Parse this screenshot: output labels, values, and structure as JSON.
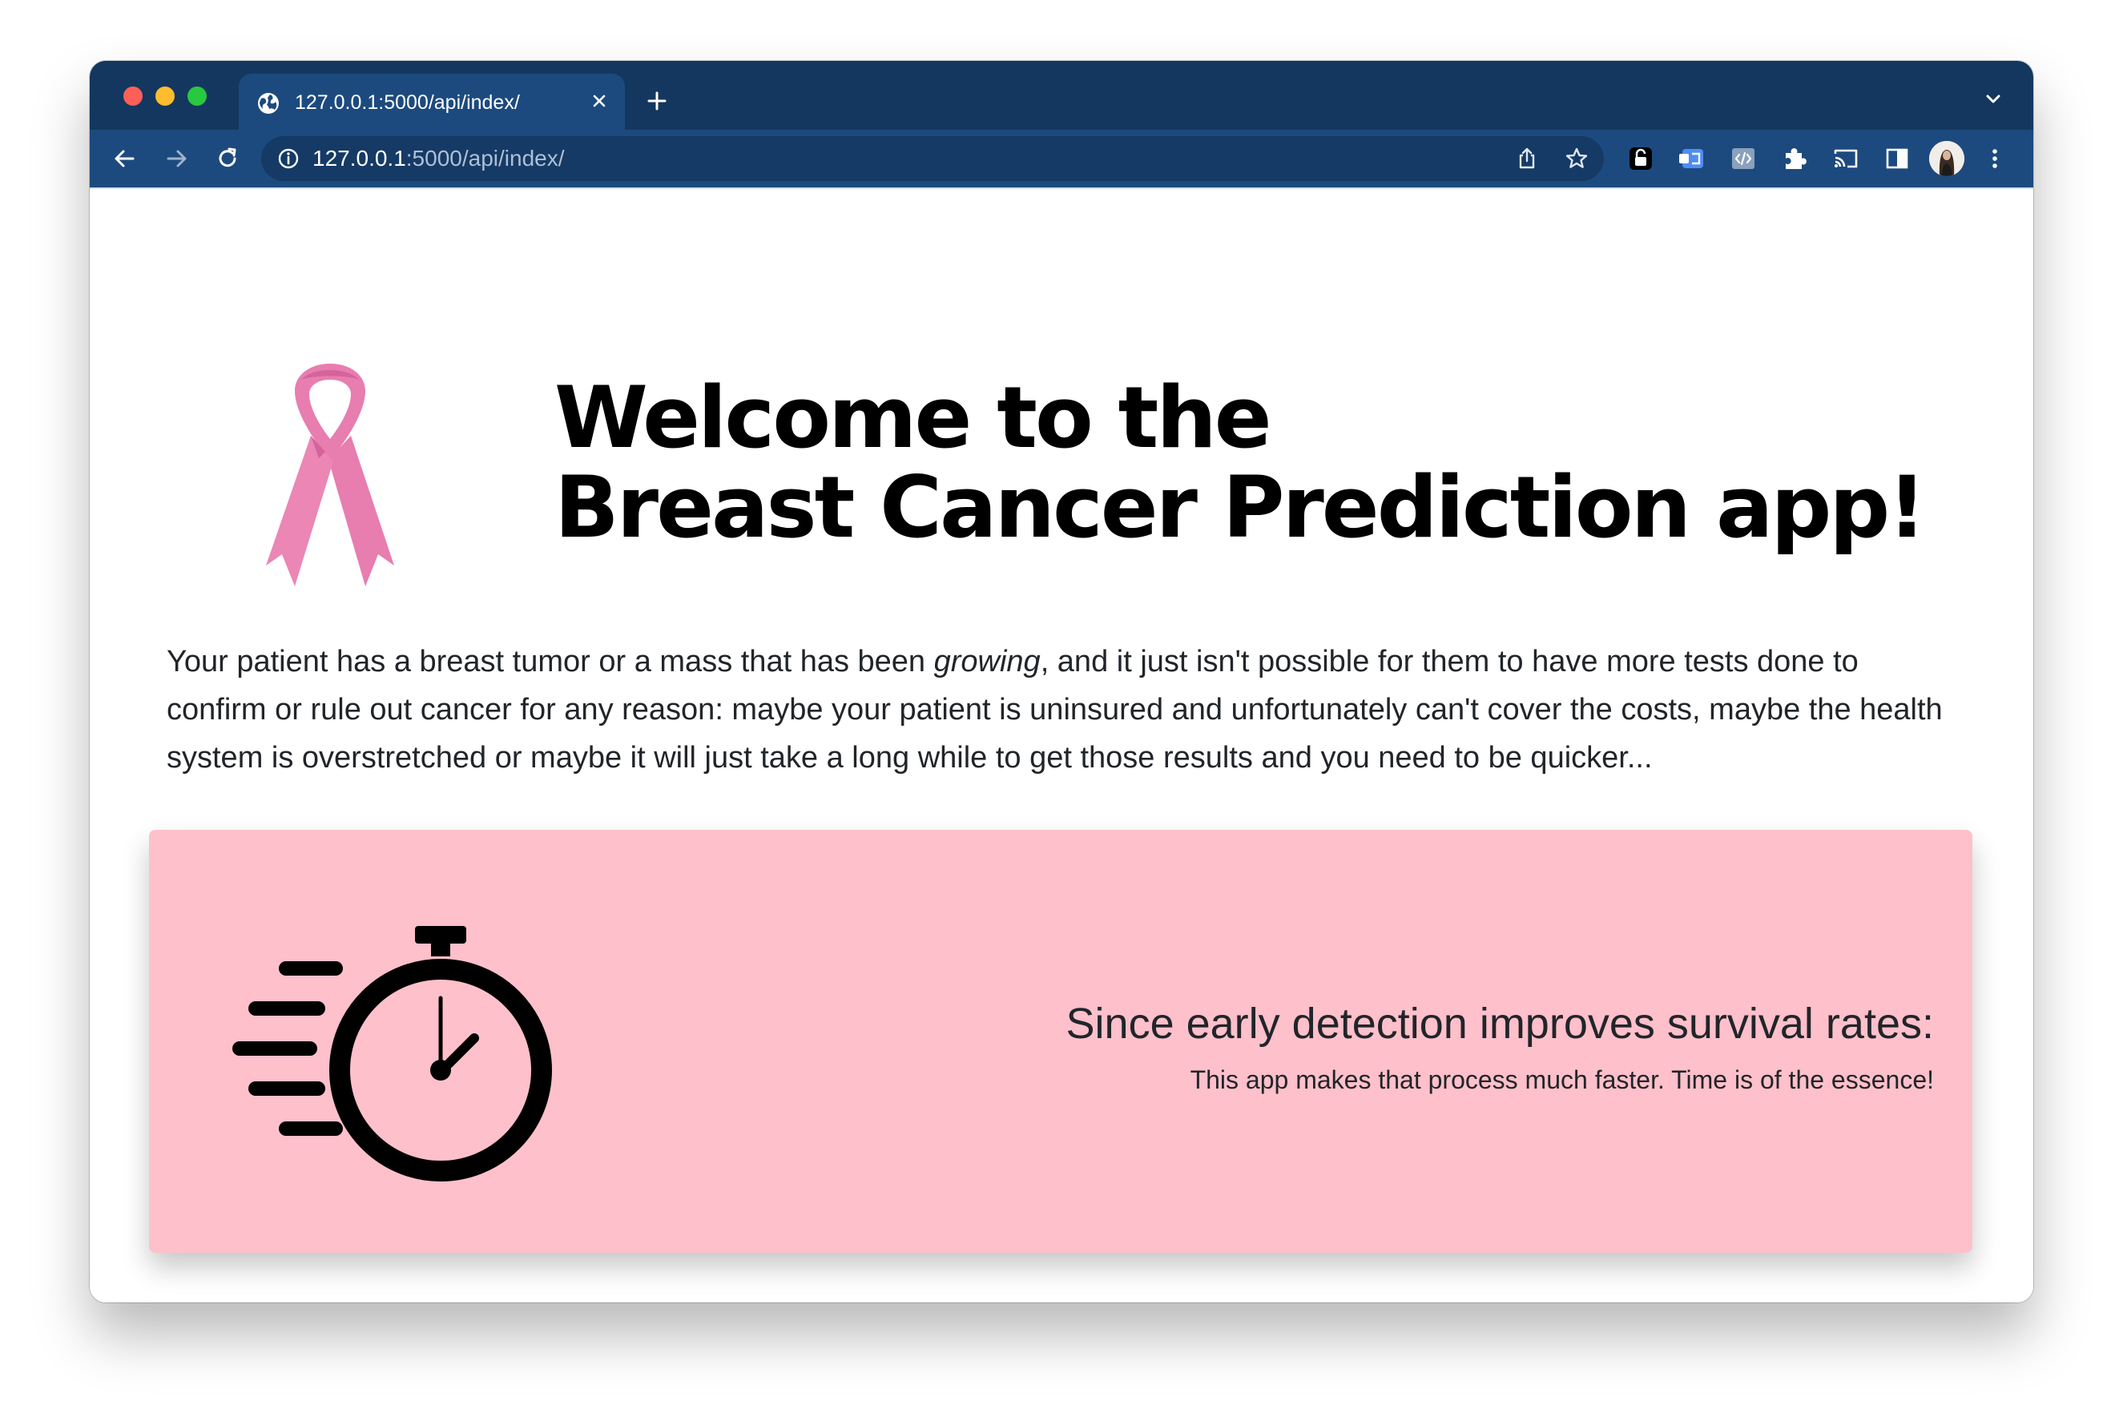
{
  "browser": {
    "tab_title": "127.0.0.1:5000/api/index/",
    "url_host": "127.0.0.1",
    "url_path": ":5000/api/index/",
    "toolbar_color": "#1d4a7e",
    "tabstrip_color": "#14375f"
  },
  "icons": {
    "tab": "globe-icon",
    "back": "arrow-left-icon",
    "forward": "arrow-right-icon",
    "reload": "reload-icon",
    "site_info": "info-icon",
    "share": "share-icon",
    "bookmark": "star-icon",
    "extensions": [
      "lock-extension-icon",
      "translate-extension-icon",
      "code-extension-icon",
      "puzzle-icon",
      "cast-icon",
      "side-panel-icon"
    ],
    "menu": "kebab-menu-icon"
  },
  "hero": {
    "title_line1": "Welcome to the",
    "title_line2": "Breast Cancer Prediction app!",
    "ribbon_color": "#e87daf"
  },
  "intro": {
    "part1": "Your patient has a breast tumor or a mass that has been ",
    "emphasis": "growing",
    "part2": ", and it just isn't possible for them to have more tests done to confirm or rule out cancer for any reason: maybe your patient is uninsured and unfortunately can't cover the costs, maybe the health system is overstretched or maybe it will just take a long while to get those results and you need to be quicker..."
  },
  "card": {
    "heading": "Since early detection improves survival rates:",
    "subtext": "This app makes that process much faster. Time is of the essence!",
    "background": "#fec0cb"
  }
}
